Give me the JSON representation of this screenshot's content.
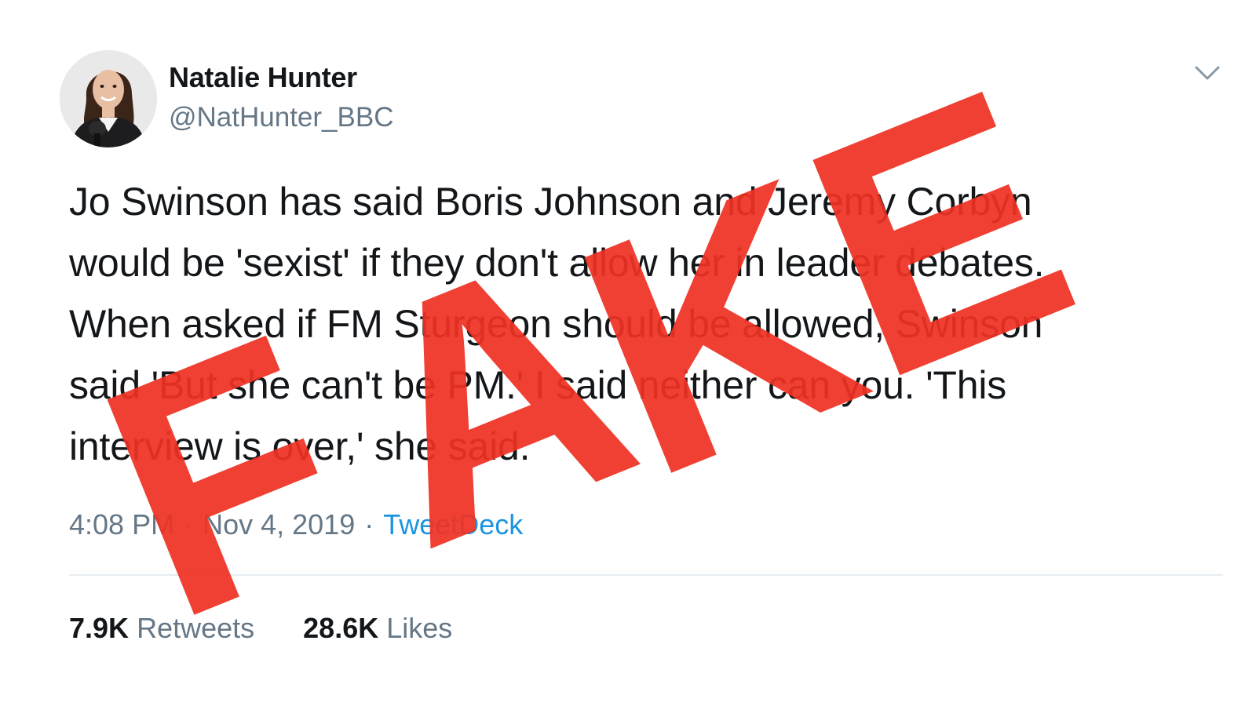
{
  "author": {
    "display_name": "Natalie Hunter",
    "handle": "@NatHunter_BBC"
  },
  "tweet": {
    "lines": [
      "Jo Swinson has said Boris Johnson and Jeremy Corbyn",
      "would be 'sexist' if they don't allow her in leader debates.",
      "When asked if FM Sturgeon should be allowed, Swinson",
      "said 'But she can't be PM.' I said neither can you. 'This",
      "interview is over,' she said."
    ],
    "time": "4:08 PM",
    "date": "Nov 4, 2019",
    "separator": "·",
    "source": "TweetDeck"
  },
  "stats": {
    "retweets_count": "7.9K",
    "retweets_label": "Retweets",
    "likes_count": "28.6K",
    "likes_label": "Likes"
  },
  "stamp": {
    "text": "FAKE",
    "color": "#ee3124"
  },
  "icons": {
    "menu": "chevron-down-icon"
  },
  "colors": {
    "secondary_text": "#657786",
    "link": "#1b95e0"
  }
}
